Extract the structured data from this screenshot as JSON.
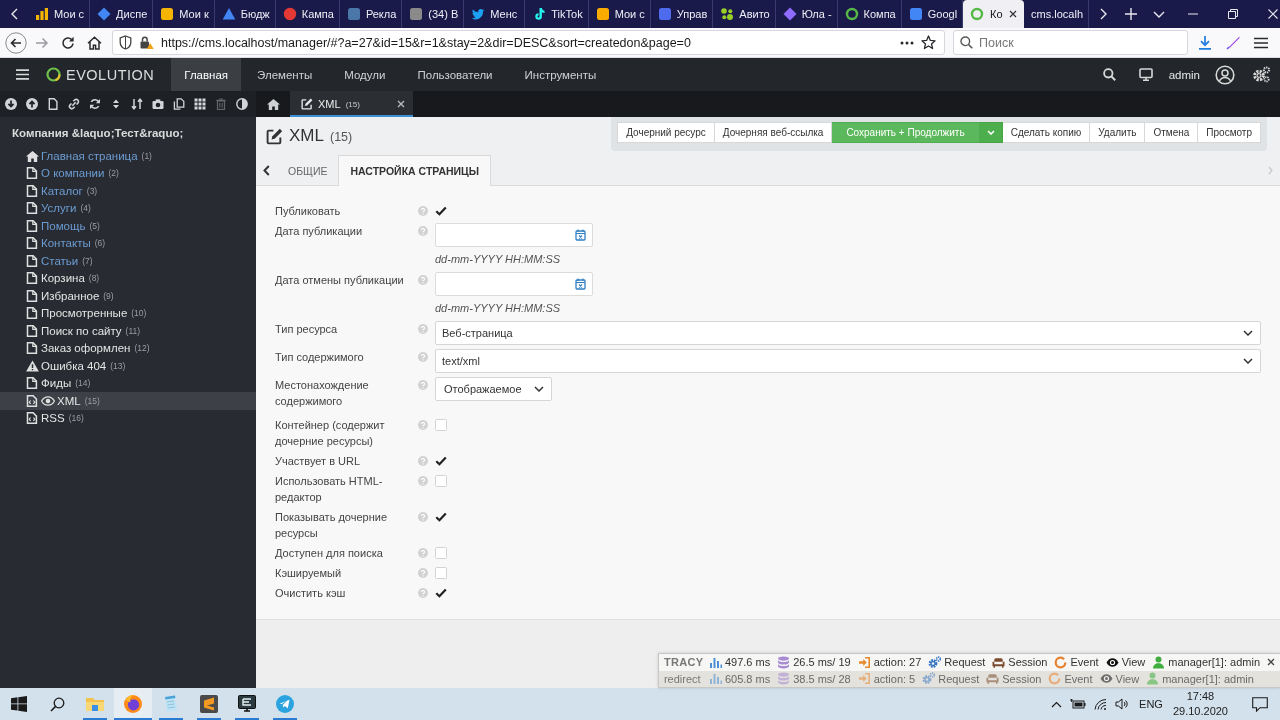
{
  "browser": {
    "tabs": [
      {
        "title": "Мои с",
        "kind": "bars",
        "color": "#f4b400",
        "selected": false
      },
      {
        "title": "Диспе",
        "kind": "diamond",
        "color": "#4285f4",
        "selected": false
      },
      {
        "title": "Мои к",
        "kind": "square",
        "color": "#f4b400",
        "selected": false
      },
      {
        "title": "Бюдж",
        "kind": "triangle",
        "color": "#4285f4",
        "selected": false
      },
      {
        "title": "Кампа",
        "kind": "circle",
        "color": "#e53935",
        "selected": false
      },
      {
        "title": "Рекла",
        "kind": "square",
        "color": "#4a76a8",
        "selected": false
      },
      {
        "title": "(34) В",
        "kind": "square",
        "color": "#8a8a8a",
        "selected": false
      },
      {
        "title": "Менс",
        "kind": "bird",
        "color": "#1da1f2",
        "selected": false
      },
      {
        "title": "TikTok",
        "kind": "note",
        "color": "#25f4ee",
        "selected": false
      },
      {
        "title": "Мои с",
        "kind": "square",
        "color": "#f9ab00",
        "selected": false
      },
      {
        "title": "Управ",
        "kind": "square",
        "color": "#4f6bed",
        "selected": false
      },
      {
        "title": "Авито",
        "kind": "dots",
        "color": "#97cf26",
        "selected": false
      },
      {
        "title": "Юла -",
        "kind": "diamond",
        "color": "#8f6bff",
        "selected": false
      },
      {
        "title": "Компа",
        "kind": "ring",
        "color": "#56b947",
        "selected": false
      },
      {
        "title": "Googl",
        "kind": "square",
        "color": "#4285f4",
        "selected": false
      },
      {
        "title": "Ко",
        "kind": "ring",
        "color": "#56b947",
        "selected": true
      },
      {
        "title": "cms.localh",
        "kind": "plain",
        "selected": false
      }
    ],
    "url": "https://cms.localhost/manager/#?a=27&id=15&r=1&stay=2&dir=DESC&sort=createdon&page=0",
    "search": {
      "placeholder": "Поиск"
    }
  },
  "header": {
    "logo": "EVOLUTION",
    "nav": [
      {
        "label": "Главная",
        "selected": true
      },
      {
        "label": "Элементы",
        "selected": false
      },
      {
        "label": "Модули",
        "selected": false
      },
      {
        "label": "Пользователи",
        "selected": false
      },
      {
        "label": "Инструменты",
        "selected": false
      }
    ],
    "user": "admin"
  },
  "sidebar": {
    "toolbar": [
      {
        "kind": "down",
        "disabled": false
      },
      {
        "kind": "up",
        "disabled": false
      },
      {
        "kind": "file",
        "disabled": false
      },
      {
        "kind": "link",
        "disabled": false
      },
      {
        "kind": "refresh",
        "disabled": false
      },
      {
        "kind": "sort",
        "disabled": false
      },
      {
        "kind": "order",
        "disabled": false
      },
      {
        "kind": "camera",
        "disabled": false
      },
      {
        "kind": "copy",
        "disabled": false
      },
      {
        "kind": "grid",
        "disabled": false
      },
      {
        "kind": "trash",
        "disabled": true
      },
      {
        "kind": "contrast",
        "disabled": false
      }
    ],
    "title": "Компания &laquo;Тест&raquo;",
    "items": [
      {
        "label": "Главная страница",
        "count": "(1)",
        "kind": "home",
        "color": "#6b9bd1",
        "selected": false
      },
      {
        "label": "О компании",
        "count": "(2)",
        "kind": "page",
        "color": "#6b9bd1",
        "selected": false
      },
      {
        "label": "Каталог",
        "count": "(3)",
        "kind": "page",
        "color": "#6b9bd1",
        "selected": false
      },
      {
        "label": "Услуги",
        "count": "(4)",
        "kind": "page",
        "color": "#6b9bd1",
        "selected": false
      },
      {
        "label": "Помощь",
        "count": "(5)",
        "kind": "page",
        "color": "#6b9bd1",
        "selected": false
      },
      {
        "label": "Контакты",
        "count": "(6)",
        "kind": "page",
        "color": "#6b9bd1",
        "selected": false
      },
      {
        "label": "Статьи",
        "count": "(7)",
        "kind": "page",
        "color": "#6b9bd1",
        "selected": false
      },
      {
        "label": "Корзина",
        "count": "(8)",
        "kind": "page",
        "color": "#e4e4e4",
        "selected": false
      },
      {
        "label": "Избранное",
        "count": "(9)",
        "kind": "page",
        "color": "#e4e4e4",
        "selected": false
      },
      {
        "label": "Просмотренные",
        "count": "(10)",
        "kind": "page",
        "color": "#e4e4e4",
        "selected": false
      },
      {
        "label": "Поиск по сайту",
        "count": "(11)",
        "kind": "page",
        "color": "#e4e4e4",
        "selected": false
      },
      {
        "label": "Заказ оформлен",
        "count": "(12)",
        "kind": "page",
        "color": "#e4e4e4",
        "selected": false
      },
      {
        "label": "Ошибка 404",
        "count": "(13)",
        "kind": "warning",
        "color": "#e4e4e4",
        "selected": false
      },
      {
        "label": "Фиды",
        "count": "(14)",
        "kind": "page",
        "color": "#e4e4e4",
        "selected": false
      },
      {
        "label": "XML",
        "count": "(15)",
        "kind": "code",
        "color": "#e4e4e4",
        "selected": true
      },
      {
        "label": "RSS",
        "count": "(16)",
        "kind": "code",
        "color": "#e4e4e4",
        "selected": false
      }
    ]
  },
  "doc_tabs": [
    {
      "label": "XML",
      "count": "(15)",
      "selected": true
    }
  ],
  "page": {
    "title": "XML",
    "count": "(15)",
    "actions": [
      {
        "label": "Дочерний ресурс",
        "kind": "default"
      },
      {
        "label": "Дочерняя веб-ссылка",
        "kind": "default"
      },
      {
        "label": "Сохранить + Продолжить",
        "kind": "primary"
      },
      {
        "label": "Сделать копию",
        "kind": "default"
      },
      {
        "label": "Удалить",
        "kind": "default"
      },
      {
        "label": "Отмена",
        "kind": "default"
      },
      {
        "label": "Просмотр",
        "kind": "default"
      }
    ],
    "tabs": [
      {
        "label": "ОБЩИЕ",
        "selected": false
      },
      {
        "label": "НАСТРОЙКА СТРАНИЦЫ",
        "selected": true
      }
    ]
  },
  "fields": [
    {
      "label": "Публиковать",
      "kind": "checkbox",
      "checked": true
    },
    {
      "label": "Дата публикации",
      "kind": "date",
      "hint": "dd-mm-YYYY HH:MM:SS"
    },
    {
      "label": "Дата отмены публикации",
      "kind": "date",
      "hint": "dd-mm-YYYY HH:MM:SS"
    },
    {
      "label": "Тип ресурса",
      "kind": "select",
      "value": "Веб-страница"
    },
    {
      "label": "Тип содержимого",
      "kind": "select",
      "value": "text/xml"
    },
    {
      "label": "Местонахождение содержимого",
      "kind": "dropdown",
      "value": "Отображаемое"
    },
    {
      "label": "Контейнер (содержит дочерние ресурсы)",
      "kind": "checkbox",
      "checked": false
    },
    {
      "label": "Участвует в URL",
      "kind": "checkbox",
      "checked": true
    },
    {
      "label": "Использовать HTML-редактор",
      "kind": "checkbox",
      "checked": false
    },
    {
      "label": "Показывать дочерние ресурсы",
      "kind": "checkbox",
      "checked": true
    },
    {
      "label": "Доступен для поиска",
      "kind": "checkbox",
      "checked": false
    },
    {
      "label": "Кэшируемый",
      "kind": "checkbox",
      "checked": false
    },
    {
      "label": "Очистить кэш",
      "kind": "checkbox",
      "checked": true
    }
  ],
  "tracy": {
    "rows": [
      {
        "label": "TRACY",
        "dimmed": false,
        "closable": true,
        "items": [
          {
            "kind": "time",
            "text": "497.6 ms"
          },
          {
            "kind": "db",
            "text": "26.5 ms/ 19"
          },
          {
            "kind": "action",
            "text": "action: 27"
          },
          {
            "kind": "request",
            "text": "Request"
          },
          {
            "kind": "session",
            "text": "Session"
          },
          {
            "kind": "event",
            "text": "Event"
          },
          {
            "kind": "view",
            "text": "View"
          },
          {
            "kind": "user",
            "text": "manager[1]: admin"
          }
        ]
      },
      {
        "label": "redirect",
        "dimmed": true,
        "closable": false,
        "items": [
          {
            "kind": "time",
            "text": "605.8 ms"
          },
          {
            "kind": "db",
            "text": "38.5 ms/ 28"
          },
          {
            "kind": "action",
            "text": "action: 5"
          },
          {
            "kind": "request",
            "text": "Request"
          },
          {
            "kind": "session",
            "text": "Session"
          },
          {
            "kind": "event",
            "text": "Event"
          },
          {
            "kind": "view",
            "text": "View"
          },
          {
            "kind": "user",
            "text": "manager[1]: admin"
          }
        ]
      }
    ]
  },
  "taskbar": {
    "apps": [
      {
        "kind": "folder",
        "selected": false,
        "running": true
      },
      {
        "kind": "firefox",
        "selected": true,
        "running": true
      },
      {
        "kind": "notepad",
        "selected": false,
        "running": true
      },
      {
        "kind": "sublime",
        "selected": false,
        "running": true
      },
      {
        "kind": "monitor",
        "selected": false,
        "running": true
      },
      {
        "kind": "telegram",
        "selected": false,
        "running": true
      }
    ],
    "lang": "ENG",
    "time": "17:48",
    "date": "29.10.2020"
  }
}
